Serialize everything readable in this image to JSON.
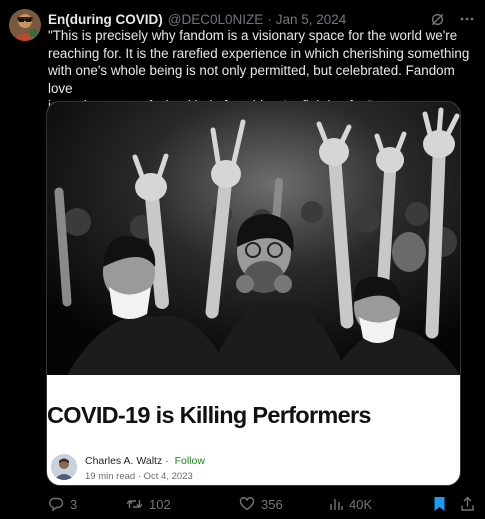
{
  "tweet": {
    "display_name": "En(during COVID)",
    "handle": "@DEC0L0NIZE",
    "separator": "·",
    "date": "Jan 5, 2024",
    "text": "\"This is precisely why fandom is a visionary space for the world we're\nreaching for. It is the rarefied experience in which cherishing  something\nwith one's whole being is not only permitted, but celebrated.  Fandom love\nis a microcosm of what kind of world we're fighting for.\""
  },
  "card": {
    "title": "COVID-19 is Killing Performers",
    "author": "Charles A. Waltz",
    "author_dot": "·",
    "follow": "Follow",
    "read_time": "19 min read",
    "meta_dot": "·",
    "published": "Oct 4, 2023",
    "image_alt": "Black and white photo of a concert crowd with raised hands, several people wearing masks and a respirator"
  },
  "actions": {
    "replies": "3",
    "retweets": "102",
    "likes": "356",
    "views": "40K"
  },
  "icons": {
    "header": [
      "grok-icon",
      "more-icon"
    ],
    "actions": [
      "reply-icon",
      "retweet-icon",
      "like-icon",
      "views-icon",
      "bookmark-icon",
      "share-icon"
    ]
  },
  "colors": {
    "background": "#000000",
    "text": "#e7e9ea",
    "muted": "#71767b",
    "bookmark_active": "#1d9bf0",
    "follow_green": "#1a8917"
  }
}
